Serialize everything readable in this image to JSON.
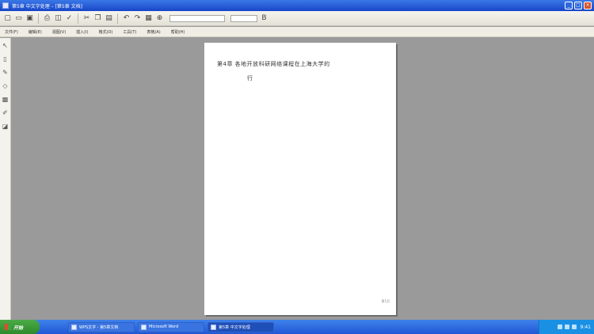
{
  "window": {
    "title": "第5章 中文字处理 – [第5章 文档]",
    "minimize_label": "_",
    "maximize_label": "□",
    "close_label": "×"
  },
  "toolbar": {
    "icons": [
      "new-doc-icon",
      "open-icon",
      "save-icon",
      "print-icon",
      "preview-icon",
      "spell-icon",
      "cut-icon",
      "copy-icon",
      "paste-icon",
      "undo-icon",
      "redo-icon",
      "table-icon",
      "zoom-icon"
    ]
  },
  "menu": {
    "items": [
      "文件(F)",
      "编辑(E)",
      "视图(V)",
      "插入(I)",
      "格式(O)",
      "工具(T)",
      "表格(A)",
      "帮助(H)"
    ]
  },
  "document": {
    "heading_line1": "第4章 各地开放科研网络课程在上海大学的",
    "heading_line2": "行",
    "page_number": "第1页"
  },
  "taskbar": {
    "start_label": "开始",
    "tasks": [
      {
        "label": "WPS文字 - 第5章文档"
      },
      {
        "label": "Microsoft Word"
      },
      {
        "label": "第5章 中文字处理"
      }
    ],
    "clock": "9:41"
  }
}
